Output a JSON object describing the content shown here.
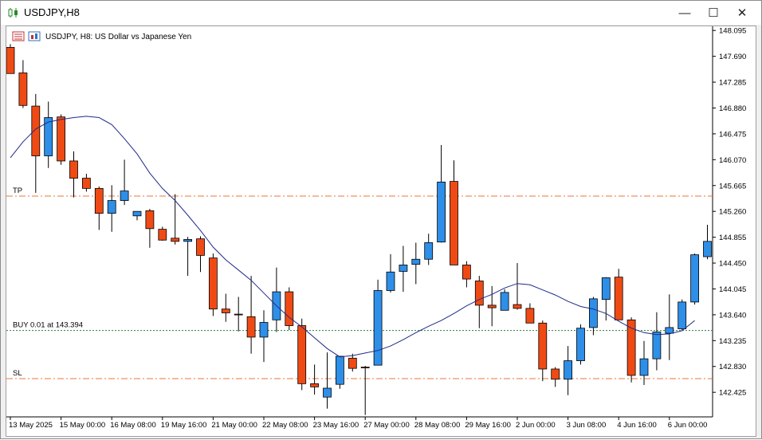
{
  "window": {
    "title": "USDJPY,H8"
  },
  "controls": {
    "minimize": "—",
    "maximize": "☐",
    "close": "✕"
  },
  "chart_header": {
    "symbol_label": "USDJPY, H8:  US Dollar vs Japanese Yen"
  },
  "levels": {
    "tp": {
      "label": "TP",
      "price": 145.5
    },
    "buy": {
      "label": "BUY 0.01 at 143.394",
      "price": 143.394
    },
    "sl": {
      "label": "SL",
      "price": 142.64
    }
  },
  "colors": {
    "bull": "#2e8fe8",
    "bear": "#f04a14",
    "wick": "#000000",
    "ma": "#1f2a8a",
    "tp_sl": "#e9773a",
    "buy": "#2f7d3a"
  },
  "chart_data": {
    "type": "candlestick",
    "y_ticks": [
      "148.095",
      "147.690",
      "147.285",
      "146.880",
      "146.475",
      "146.070",
      "145.665",
      "145.260",
      "144.855",
      "144.450",
      "144.045",
      "143.640",
      "143.235",
      "142.830",
      "142.425"
    ],
    "ylim": [
      142.04,
      148.16
    ],
    "x_ticks": [
      {
        "label": "13 May 2025",
        "index": 0
      },
      {
        "label": "15 May 00:00",
        "index": 4
      },
      {
        "label": "16 May 08:00",
        "index": 8
      },
      {
        "label": "19 May 16:00",
        "index": 12
      },
      {
        "label": "21 May 00:00",
        "index": 16
      },
      {
        "label": "22 May 08:00",
        "index": 20
      },
      {
        "label": "23 May 16:00",
        "index": 24
      },
      {
        "label": "27 May 00:00",
        "index": 28
      },
      {
        "label": "28 May 08:00",
        "index": 32
      },
      {
        "label": "29 May 16:00",
        "index": 36
      },
      {
        "label": "2 Jun 00:00",
        "index": 40
      },
      {
        "label": "3 Jun 08:00",
        "index": 44
      },
      {
        "label": "4 Jun 16:00",
        "index": 48
      },
      {
        "label": "6 Jun 00:00",
        "index": 52
      }
    ],
    "candles": [
      {
        "o": 147.83,
        "h": 147.88,
        "l": 147.42,
        "c": 147.42
      },
      {
        "o": 147.43,
        "h": 147.63,
        "l": 146.88,
        "c": 146.92
      },
      {
        "o": 146.91,
        "h": 147.1,
        "l": 145.55,
        "c": 146.13
      },
      {
        "o": 146.13,
        "h": 146.98,
        "l": 145.94,
        "c": 146.73
      },
      {
        "o": 146.74,
        "h": 146.78,
        "l": 145.99,
        "c": 146.05
      },
      {
        "o": 146.05,
        "h": 146.2,
        "l": 145.48,
        "c": 145.78
      },
      {
        "o": 145.78,
        "h": 145.85,
        "l": 145.57,
        "c": 145.62
      },
      {
        "o": 145.62,
        "h": 145.65,
        "l": 144.97,
        "c": 145.23
      },
      {
        "o": 145.23,
        "h": 145.67,
        "l": 144.94,
        "c": 145.43
      },
      {
        "o": 145.43,
        "h": 146.07,
        "l": 145.36,
        "c": 145.58
      },
      {
        "o": 145.19,
        "h": 145.24,
        "l": 145.12,
        "c": 145.26
      },
      {
        "o": 145.27,
        "h": 145.3,
        "l": 144.69,
        "c": 144.99
      },
      {
        "o": 144.98,
        "h": 145.02,
        "l": 144.8,
        "c": 144.81
      },
      {
        "o": 144.84,
        "h": 145.53,
        "l": 144.74,
        "c": 144.79
      },
      {
        "o": 144.79,
        "h": 144.86,
        "l": 144.25,
        "c": 144.82
      },
      {
        "o": 144.83,
        "h": 144.87,
        "l": 144.31,
        "c": 144.57
      },
      {
        "o": 144.53,
        "h": 144.6,
        "l": 143.62,
        "c": 143.73
      },
      {
        "o": 143.73,
        "h": 143.97,
        "l": 143.53,
        "c": 143.67
      },
      {
        "o": 143.65,
        "h": 143.92,
        "l": 143.38,
        "c": 143.64
      },
      {
        "o": 143.61,
        "h": 144.25,
        "l": 143.03,
        "c": 143.29
      },
      {
        "o": 143.29,
        "h": 143.71,
        "l": 142.9,
        "c": 143.52
      },
      {
        "o": 143.56,
        "h": 144.38,
        "l": 143.37,
        "c": 144.0
      },
      {
        "o": 144.0,
        "h": 144.07,
        "l": 143.4,
        "c": 143.47
      },
      {
        "o": 143.47,
        "h": 143.58,
        "l": 142.46,
        "c": 142.56
      },
      {
        "o": 142.56,
        "h": 142.86,
        "l": 142.39,
        "c": 142.51
      },
      {
        "o": 142.35,
        "h": 143.05,
        "l": 142.17,
        "c": 142.49
      },
      {
        "o": 142.55,
        "h": 142.98,
        "l": 142.48,
        "c": 142.99
      },
      {
        "o": 142.96,
        "h": 143.03,
        "l": 142.75,
        "c": 142.8
      },
      {
        "o": 142.82,
        "h": 142.84,
        "l": 142.07,
        "c": 142.81
      },
      {
        "o": 142.85,
        "h": 144.19,
        "l": 142.85,
        "c": 144.02
      },
      {
        "o": 144.02,
        "h": 144.59,
        "l": 143.99,
        "c": 144.31
      },
      {
        "o": 144.32,
        "h": 144.72,
        "l": 144.0,
        "c": 144.42
      },
      {
        "o": 144.43,
        "h": 144.77,
        "l": 144.12,
        "c": 144.51
      },
      {
        "o": 144.51,
        "h": 144.91,
        "l": 144.42,
        "c": 144.77
      },
      {
        "o": 144.78,
        "h": 146.3,
        "l": 144.77,
        "c": 145.72
      },
      {
        "o": 145.73,
        "h": 146.06,
        "l": 144.45,
        "c": 144.42
      },
      {
        "o": 144.42,
        "h": 144.48,
        "l": 144.07,
        "c": 144.2
      },
      {
        "o": 144.17,
        "h": 144.25,
        "l": 143.43,
        "c": 143.79
      },
      {
        "o": 143.79,
        "h": 144.09,
        "l": 143.46,
        "c": 143.75
      },
      {
        "o": 143.71,
        "h": 144.04,
        "l": 143.73,
        "c": 143.99
      },
      {
        "o": 143.8,
        "h": 144.45,
        "l": 143.72,
        "c": 143.74
      },
      {
        "o": 143.74,
        "h": 143.82,
        "l": 143.55,
        "c": 143.51
      },
      {
        "o": 143.51,
        "h": 143.55,
        "l": 142.6,
        "c": 142.79
      },
      {
        "o": 142.79,
        "h": 142.82,
        "l": 142.51,
        "c": 142.63
      },
      {
        "o": 142.63,
        "h": 143.15,
        "l": 142.38,
        "c": 142.92
      },
      {
        "o": 142.92,
        "h": 143.49,
        "l": 142.86,
        "c": 143.43
      },
      {
        "o": 143.44,
        "h": 143.92,
        "l": 143.32,
        "c": 143.89
      },
      {
        "o": 143.88,
        "h": 144.23,
        "l": 143.55,
        "c": 144.22
      },
      {
        "o": 144.23,
        "h": 144.36,
        "l": 143.56,
        "c": 143.56
      },
      {
        "o": 143.56,
        "h": 143.6,
        "l": 142.58,
        "c": 142.69
      },
      {
        "o": 142.69,
        "h": 143.23,
        "l": 142.54,
        "c": 142.95
      },
      {
        "o": 142.95,
        "h": 143.68,
        "l": 142.77,
        "c": 143.37
      },
      {
        "o": 143.35,
        "h": 143.96,
        "l": 142.93,
        "c": 143.44
      },
      {
        "o": 143.42,
        "h": 143.88,
        "l": 143.4,
        "c": 143.84
      },
      {
        "o": 143.84,
        "h": 144.6,
        "l": 143.8,
        "c": 144.58
      },
      {
        "o": 144.55,
        "h": 145.05,
        "l": 144.51,
        "c": 144.79
      }
    ],
    "ma": [
      146.1,
      146.35,
      146.55,
      146.66,
      146.7,
      146.73,
      146.75,
      146.73,
      146.62,
      146.4,
      146.16,
      145.86,
      145.62,
      145.43,
      145.2,
      144.96,
      144.7,
      144.5,
      144.34,
      144.18,
      143.98,
      143.78,
      143.6,
      143.45,
      143.28,
      143.11,
      142.98,
      143.0,
      143.04,
      143.08,
      143.15,
      143.25,
      143.36,
      143.46,
      143.55,
      143.66,
      143.78,
      143.88,
      143.96,
      144.06,
      144.13,
      144.11,
      144.03,
      143.95,
      143.85,
      143.77,
      143.73,
      143.66,
      143.54,
      143.43,
      143.36,
      143.33,
      143.34,
      143.39,
      143.55
    ]
  }
}
